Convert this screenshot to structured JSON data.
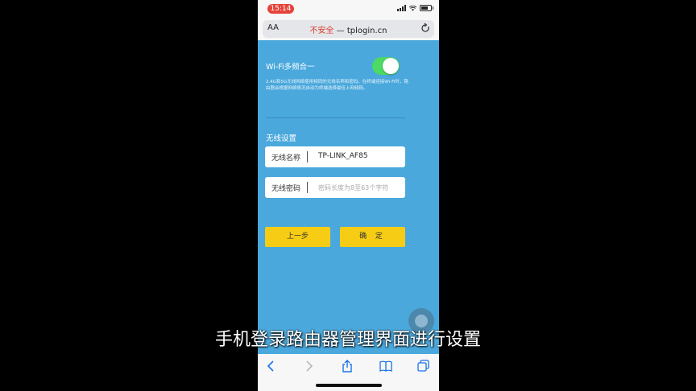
{
  "statusbar": {
    "time": "15:14"
  },
  "browser": {
    "text_size_label": "AA",
    "security_label": "不安全",
    "separator": " — ",
    "domain": "tplogin.cn"
  },
  "wifi": {
    "merge_title": "Wi-Fi多频合一",
    "merge_enabled": true,
    "description": "2.4G和5G无线网络使用相同的无线名称和密码。在终端连接Wi-Fi时，路由器会根据网络情况自动为终端选择最佳上网频段。"
  },
  "wireless": {
    "section_title": "无线设置",
    "name_label": "无线名称",
    "name_value": "TP-LINK_AF85",
    "password_label": "无线密码",
    "password_placeholder": "密码长度为8至63个字符"
  },
  "buttons": {
    "prev": "上一步",
    "confirm": "确 定"
  },
  "caption": "手机登录路由器管理界面进行设置",
  "colors": {
    "page_bg": "#4aa8dc",
    "button": "#f6cd14",
    "toggle_on": "#4cd964",
    "insecure": "#d93a2e"
  }
}
